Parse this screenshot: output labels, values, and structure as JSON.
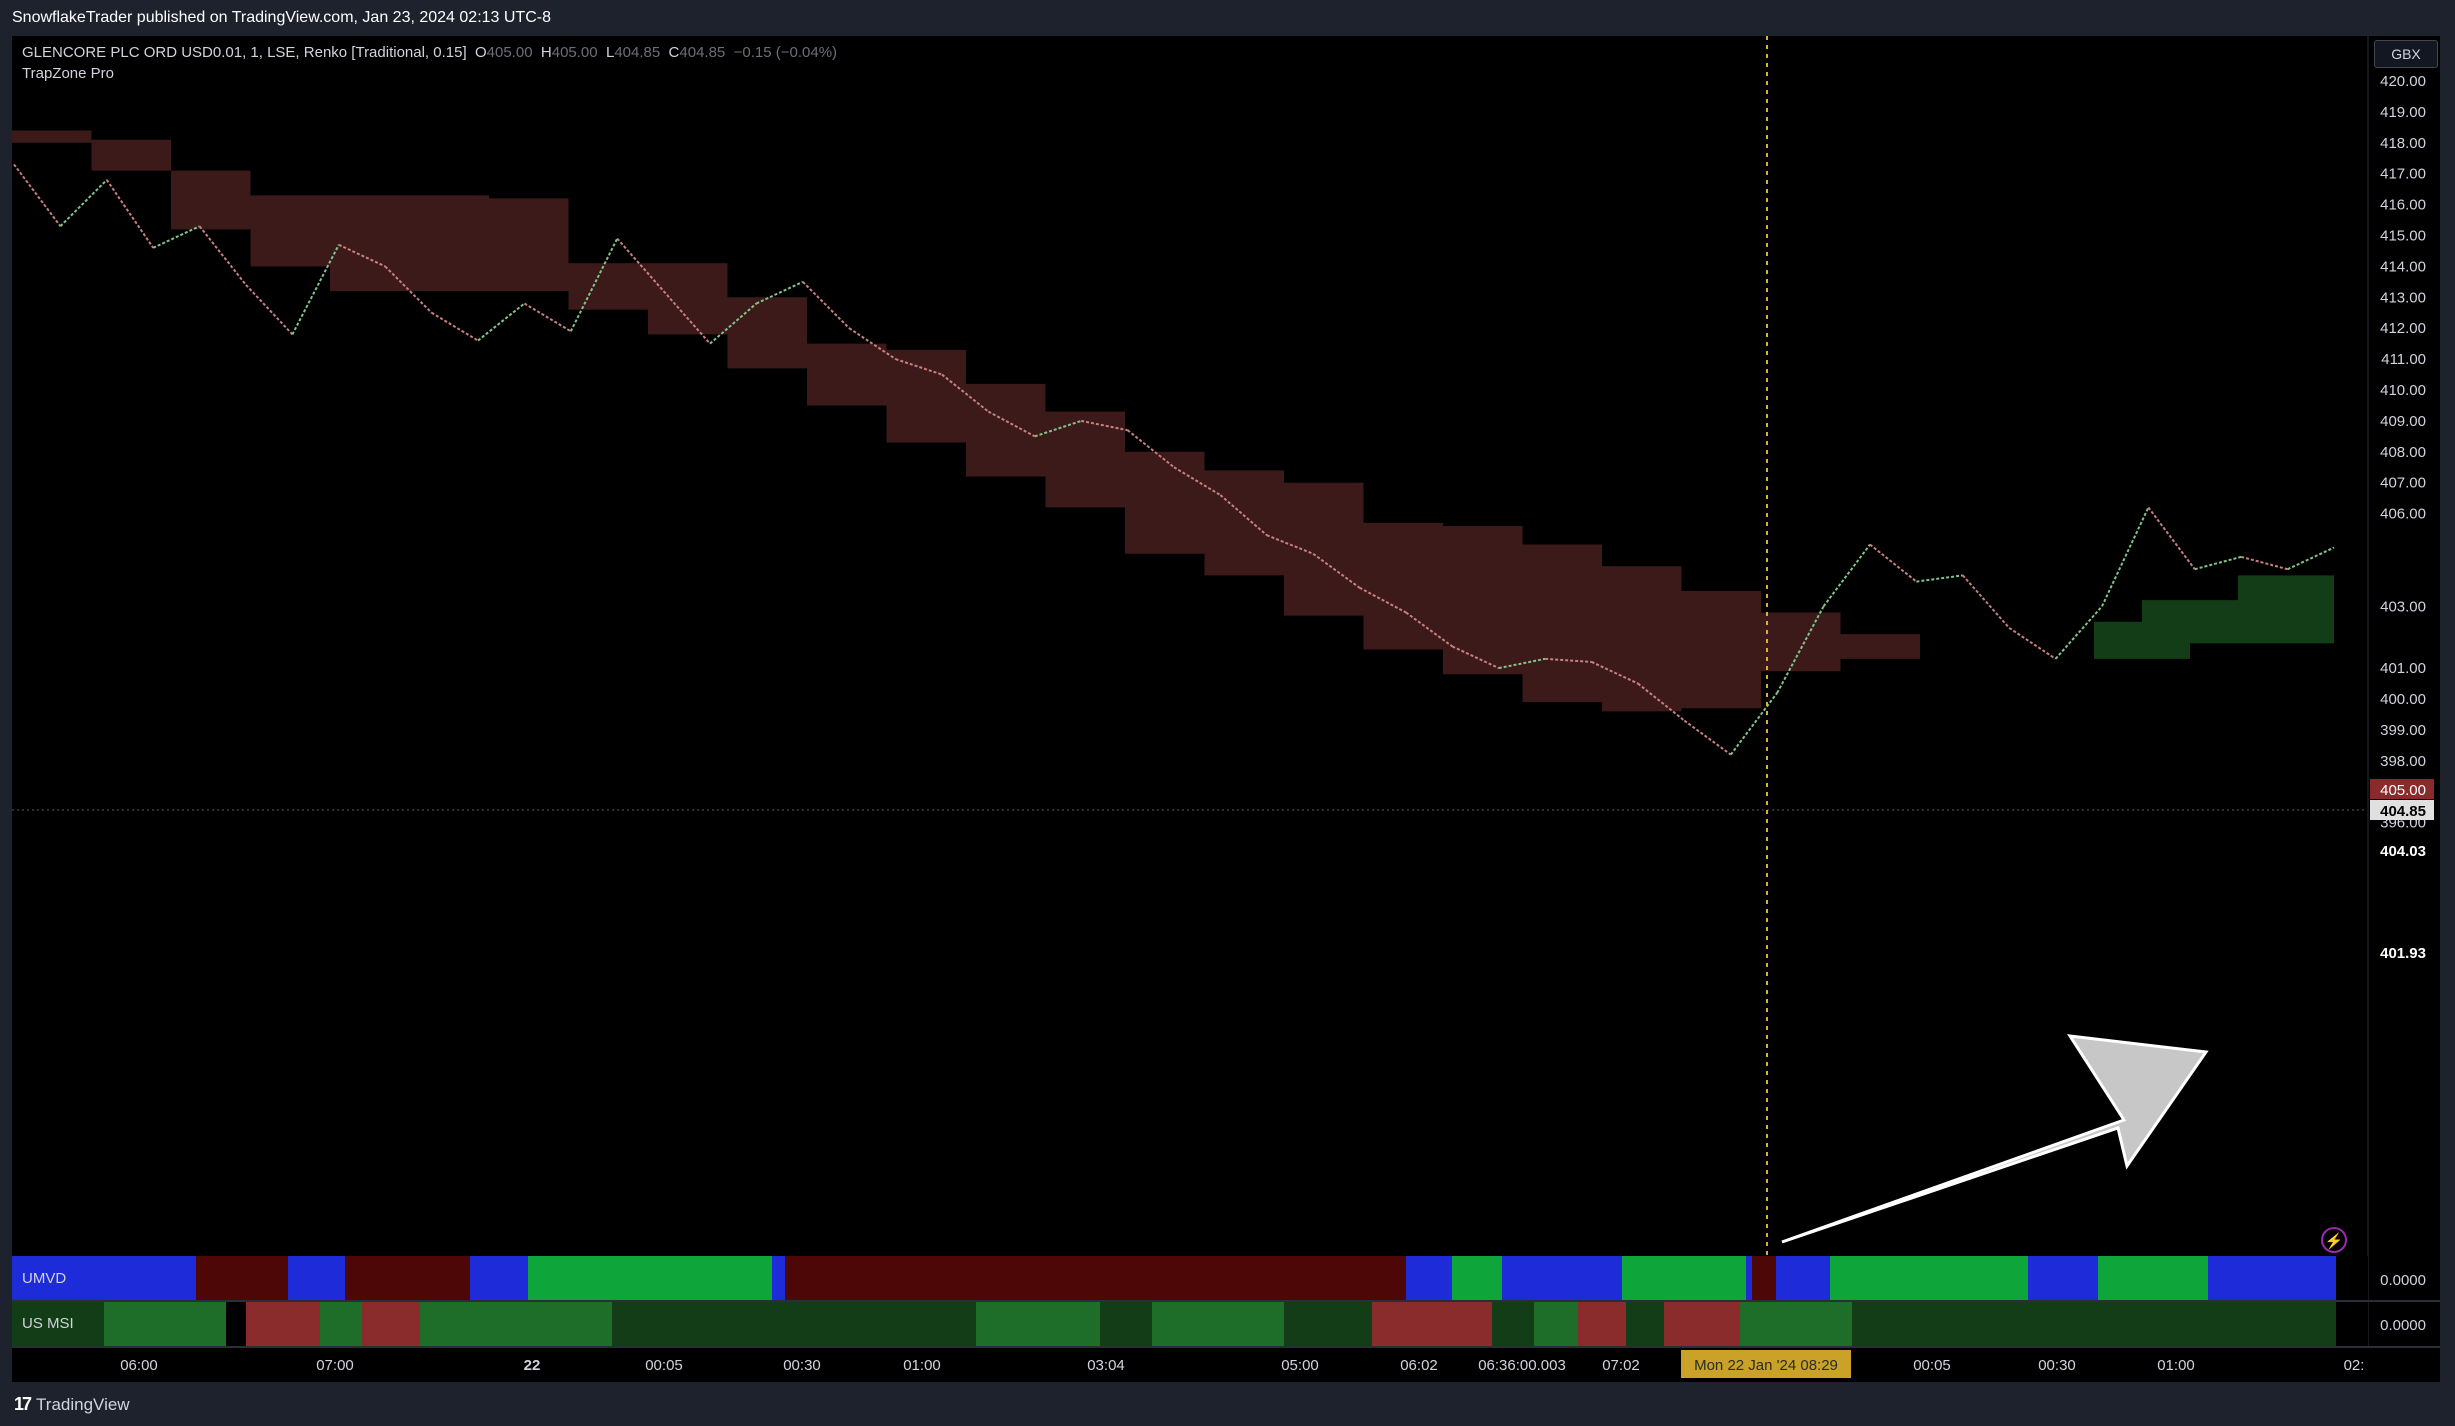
{
  "header": {
    "publisher_text": "SnowflakeTrader published on TradingView.com, Jan 23, 2024 02:13 UTC-8"
  },
  "legend": {
    "symbol": "GLENCORE PLC ORD USD0.01, 1, LSE, Renko [Traditional, 0.15]",
    "o_label": "O",
    "o_value": "405.00",
    "h_label": "H",
    "h_value": "405.00",
    "l_label": "L",
    "l_value": "404.85",
    "c_label": "C",
    "c_value": "404.85",
    "change": "−0.15 (−0.04%)",
    "indicator": "TrapZone Pro"
  },
  "currency_button": "GBX",
  "price_axis": {
    "ticks": [
      "420.00",
      "419.00",
      "418.00",
      "417.00",
      "416.00",
      "415.00",
      "414.00",
      "413.00",
      "412.00",
      "411.00",
      "410.00",
      "409.00",
      "408.00",
      "407.00",
      "406.00",
      "403.00",
      "401.00",
      "400.00",
      "399.00",
      "398.00",
      "397.00",
      "396.00"
    ],
    "label_405": "405.00",
    "label_40485": "404.85",
    "label_40403": "404.03",
    "label_40193": "401.93"
  },
  "time_axis": {
    "ticks": [
      "06:00",
      "07:00",
      "22",
      "00:05",
      "00:30",
      "01:00",
      "03:04",
      "05:00",
      "06:02",
      "06:36:00.003",
      "07:02",
      "00:05",
      "00:30",
      "01:00",
      "02:"
    ],
    "crosshair_label": "Mon 22 Jan '24   08:29"
  },
  "panes": {
    "umvd": {
      "label": "UMVD",
      "value": "0.0000"
    },
    "usmsi": {
      "label": "US MSI",
      "value": "0.0000"
    }
  },
  "footer": {
    "brand": "TradingView",
    "logo_mark": "17"
  },
  "colors": {
    "bear_zone": "#3d1a1a",
    "bull_zone": "#123d17",
    "renko_down": "#c98080",
    "renko_up": "#80c48a",
    "crosshair": "#d9b22f",
    "umvd_blue": "#1d2bd8",
    "umvd_green": "#0ea53a",
    "umvd_red": "#4e0707",
    "msi_green": "#1e6e2a",
    "msi_red": "#8b2c2c",
    "msi_darkgreen": "#123d17"
  },
  "chart_data": {
    "type": "line",
    "title": "",
    "xlabel": "",
    "ylabel": "",
    "ylim": [
      395.3,
      420.2
    ],
    "x": [
      0,
      2,
      4,
      6,
      8,
      10,
      12,
      14,
      16,
      18,
      20,
      22,
      24,
      26,
      28,
      30,
      32,
      34,
      36,
      38,
      40,
      42,
      44,
      46,
      48,
      50,
      52,
      54,
      56,
      58,
      60,
      62,
      64,
      66,
      68,
      70,
      72,
      74,
      76,
      78,
      80,
      82,
      84,
      86,
      88,
      90,
      92,
      94,
      96,
      98,
      100
    ],
    "series": [
      {
        "values": [
          417.3,
          415.3,
          416.8,
          414.6,
          415.3,
          413.4,
          411.8,
          414.7,
          414.0,
          412.5,
          411.6,
          412.8,
          411.9,
          414.9,
          413.2,
          411.5,
          412.8,
          413.5,
          412.0,
          411.0,
          410.5,
          409.3,
          408.5,
          409.0,
          408.7,
          407.5,
          406.6,
          405.3,
          404.7,
          403.6,
          402.8,
          401.7,
          401.0,
          401.3,
          401.2,
          400.5,
          399.3,
          398.2,
          400.2,
          403.0,
          405.0,
          403.8,
          404.0,
          402.3,
          401.3,
          403.0,
          406.2,
          404.2,
          404.6,
          404.2,
          404.9
        ]
      }
    ],
    "bands": {
      "bear_zone_top": [
        418.4,
        418.1,
        417.1,
        416.3,
        416.3,
        416.3,
        416.2,
        414.1,
        414.1,
        413.0,
        411.5,
        411.3,
        410.2,
        409.3,
        408.0,
        407.4,
        407.0,
        405.7,
        405.6,
        405.0,
        404.3,
        403.5,
        402.8,
        402.1,
        401.3
      ],
      "bear_zone_bottom": [
        418.0,
        417.1,
        415.2,
        414.0,
        413.2,
        413.2,
        413.2,
        412.6,
        411.8,
        410.7,
        409.5,
        408.3,
        407.2,
        406.2,
        404.7,
        404.0,
        402.7,
        401.6,
        400.8,
        399.9,
        399.6,
        399.7,
        400.9,
        401.3,
        401.3
      ],
      "bull_zone_top": [
        401.3,
        402.5,
        403.2,
        403.2,
        404.0,
        404.0,
        404.0
      ],
      "bull_zone_bottom": [
        401.3,
        401.3,
        401.3,
        401.8,
        401.8,
        401.8,
        401.8
      ]
    },
    "current_price": 404.85,
    "grid": false,
    "legend": "top-left"
  }
}
